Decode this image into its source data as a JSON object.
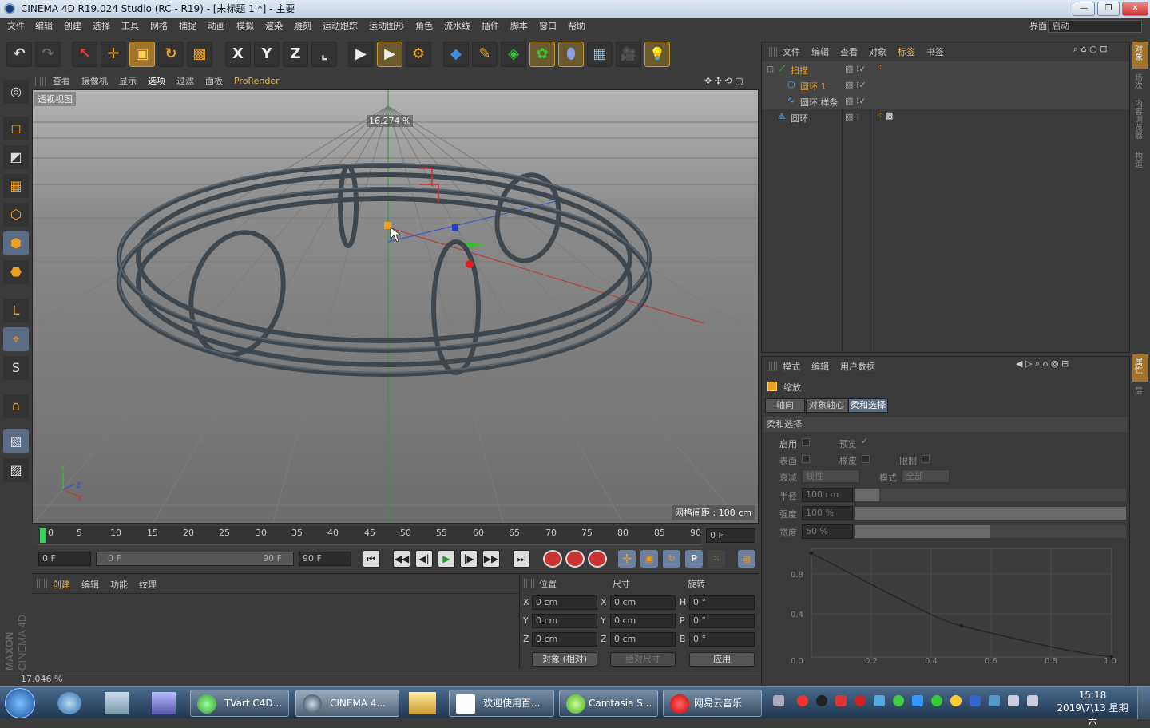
{
  "window": {
    "title": "CINEMA 4D R19.024 Studio (RC - R19) - [未标题 1 *] - 主要",
    "min_label": "—",
    "max_label": "❐",
    "close_label": "✕"
  },
  "menu": {
    "items": [
      "文件",
      "编辑",
      "创建",
      "选择",
      "工具",
      "网格",
      "捕捉",
      "动画",
      "模拟",
      "渲染",
      "雕刻",
      "运动跟踪",
      "运动图形",
      "角色",
      "流水线",
      "插件",
      "脚本",
      "窗口",
      "帮助"
    ],
    "layout_label": "界面:",
    "layout_value": "启动"
  },
  "toolbar": {
    "undo": "↶",
    "redo": "↷",
    "select": "↖",
    "move": "✛",
    "scale": "▣",
    "rotate": "↻",
    "recent": "▩",
    "x": "X",
    "y": "Y",
    "z": "Z",
    "coord": "⌞",
    "render_view": "▶",
    "render": "▶",
    "render_settings": "⚙",
    "cube": "◆",
    "pen": "✎",
    "subdiv": "◈",
    "array": "✿",
    "deformer": "⬮",
    "floor": "▦",
    "camera": "🎥",
    "light": "💡"
  },
  "left_tools": [
    "◎",
    "◻",
    "◩",
    "▦",
    "⬡",
    "⬢",
    "⬣",
    "L",
    "⌖",
    "S",
    "∩",
    "▧",
    "▨"
  ],
  "viewport": {
    "tabs": [
      "查看",
      "摄像机",
      "显示",
      "选项",
      "过滤",
      "面板",
      "ProRender"
    ],
    "label": "透视视图",
    "percent": "16.274 %",
    "grid_spacing": "网格间距 : 100 cm",
    "axis_x": "X",
    "axis_y": "Y",
    "axis_z": "Z"
  },
  "timeline": {
    "ticks": [
      "0",
      "5",
      "10",
      "15",
      "20",
      "25",
      "30",
      "35",
      "40",
      "45",
      "50",
      "55",
      "60",
      "65",
      "70",
      "75",
      "80",
      "85",
      "90"
    ],
    "current": "0 F"
  },
  "transport": {
    "start": "0 F",
    "range_start": "0 F",
    "range_end": "90 F",
    "end": "90 F",
    "buttons": [
      "⏮",
      "◀◀",
      "◀|",
      "▶",
      "|▶",
      "▶▶",
      "⏭"
    ]
  },
  "material_panel": {
    "tabs": [
      "创建",
      "编辑",
      "功能",
      "纹理"
    ]
  },
  "coords": {
    "headers": [
      "位置",
      "尺寸",
      "旋转"
    ],
    "rows": [
      {
        "a": "X",
        "av": "0 cm",
        "b": "X",
        "bv": "0 cm",
        "c": "H",
        "cv": "0 °"
      },
      {
        "a": "Y",
        "av": "0 cm",
        "b": "Y",
        "bv": "0 cm",
        "c": "P",
        "cv": "0 °"
      },
      {
        "a": "Z",
        "av": "0 cm",
        "b": "Z",
        "bv": "0 cm",
        "c": "B",
        "cv": "0 °"
      }
    ],
    "mode": "对象 (相对)",
    "size_mode": "绝对尺寸",
    "apply": "应用"
  },
  "status": {
    "text": "17.046 %"
  },
  "objects": {
    "menu": [
      "文件",
      "编辑",
      "查看",
      "对象",
      "标签",
      "书签"
    ],
    "tree": [
      {
        "name": "扫描",
        "level": 0,
        "color": "#e8a020"
      },
      {
        "name": "圆环.1",
        "level": 1,
        "color": "#e8a020"
      },
      {
        "name": "圆环.样条",
        "level": 1,
        "color": "#c8c8c8"
      },
      {
        "name": "圆环",
        "level": 0,
        "color": "#c8c8c8"
      }
    ]
  },
  "attributes": {
    "menu": [
      "模式",
      "编辑",
      "用户数据"
    ],
    "object": "缩放",
    "tabs": [
      "轴向",
      "对象轴心",
      "柔和选择"
    ],
    "section": "柔和选择",
    "enable": "启用",
    "preview": "预览",
    "surface": "表面",
    "rubber": "橡皮",
    "limit": "限制",
    "falloff": "衰减",
    "falloff_value": "线性",
    "mode": "模式",
    "mode_value": "全部",
    "radius": "半径",
    "radius_value": "100 cm",
    "radius_frac": 0.09,
    "strength": "强度",
    "strength_value": "100 %",
    "strength_frac": 1.0,
    "width": "宽度",
    "width_value": "50 %",
    "width_frac": 0.5,
    "graph_y": [
      "0.8",
      "0.4",
      "0.0"
    ],
    "graph_x": [
      "0.2",
      "0.4",
      "0.6",
      "0.8",
      "1.0"
    ]
  },
  "right_strip": [
    "对象",
    "场次",
    "内容浏览器",
    "构造",
    "属性",
    "层"
  ],
  "brand": {
    "maxon": "MAXON",
    "c4d": "CINEMA 4D"
  },
  "taskbar": {
    "apps": [
      "TVart C4D...",
      "CINEMA 4...",
      "欢迎使用百...",
      "Camtasia S...",
      "网易云音乐"
    ],
    "time": "15:18",
    "date": "2019\\7\\13 星期六"
  }
}
